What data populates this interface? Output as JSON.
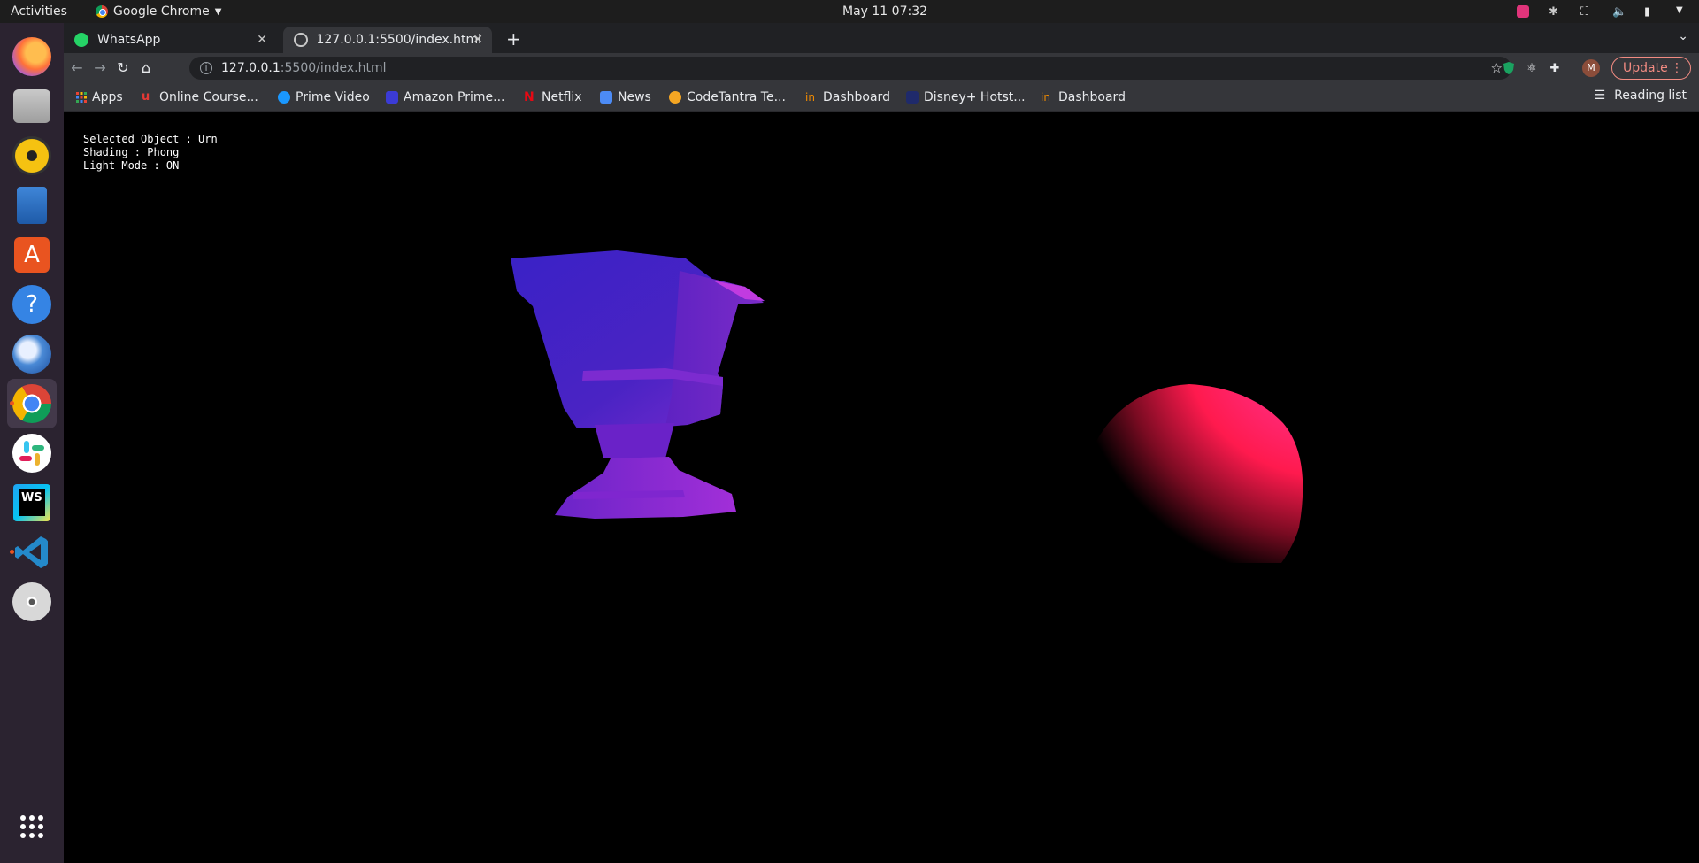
{
  "topbar": {
    "activities": "Activities",
    "app_name": "Google Chrome",
    "clock": "May 11  07:32"
  },
  "dock": {
    "items": [
      {
        "name": "firefox-icon",
        "color": "#ff7139"
      },
      {
        "name": "files-icon",
        "color": "#b8b8b8"
      },
      {
        "name": "rhythmbox-icon",
        "color": "#f5c211"
      },
      {
        "name": "writer-icon",
        "color": "#2a6db5"
      },
      {
        "name": "software-center-icon",
        "color": "#e95420"
      },
      {
        "name": "help-icon",
        "color": "#3584e4"
      },
      {
        "name": "thunderbird-icon",
        "color": "#4a8ad6"
      },
      {
        "name": "chrome-icon",
        "color": "#4285f4"
      },
      {
        "name": "slack-icon",
        "color": "#ffffff"
      },
      {
        "name": "webstorm-icon",
        "color": "#1ea3f2"
      },
      {
        "name": "vscode-icon",
        "color": "#2489ca"
      },
      {
        "name": "dvd-icon",
        "color": "#d0d0d0"
      }
    ],
    "show_apps_icon": "grid-icon"
  },
  "browser": {
    "tabs": [
      {
        "title": "WhatsApp",
        "active": false
      },
      {
        "title": "127.0.0.1:5500/index.html",
        "active": true
      }
    ],
    "url_host": "127.0.0.1",
    "url_path": ":5500/index.html",
    "update_label": "Update",
    "profile_initial": "M",
    "bookmarks": [
      {
        "label": "Apps",
        "color": "#4285f4"
      },
      {
        "label": "Online Course...",
        "color": "#e53935"
      },
      {
        "label": "Prime Video",
        "color": "#1a98ff"
      },
      {
        "label": "Amazon Prime...",
        "color": "#3b3bd6"
      },
      {
        "label": "Netflix",
        "color": "#e50914"
      },
      {
        "label": "News",
        "color": "#4c8bf5"
      },
      {
        "label": "CodeTantra Te...",
        "color": "#f5a623"
      },
      {
        "label": "Dashboard",
        "color": "#f28b00"
      },
      {
        "label": "Disney+ Hotst...",
        "color": "#1f2a6b"
      },
      {
        "label": "Dashboard",
        "color": "#f28b00"
      }
    ],
    "reading_list": "Reading list"
  },
  "scene": {
    "hud": {
      "selected_object": "Selected Object : Urn",
      "shading": "Shading : Phong",
      "light_mode": "Light Mode : ON"
    },
    "urn_color_top": "#3d22c4",
    "urn_color_base": "#9b2ad6",
    "sphere_color_light": "#ff5ad8",
    "sphere_color_mid": "#ff1a5a"
  }
}
